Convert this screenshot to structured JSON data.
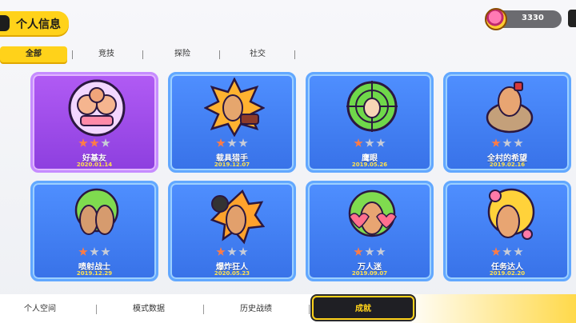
{
  "header": {
    "title": "个人信息",
    "coins": "3330"
  },
  "tabs": [
    {
      "label": "全部",
      "active": true
    },
    {
      "label": "竞技",
      "active": false
    },
    {
      "label": "探险",
      "active": false
    },
    {
      "label": "社交",
      "active": false
    }
  ],
  "achievements": [
    {
      "name": "好基友",
      "date": "2020.01.14",
      "color": "purple",
      "stars": [
        true,
        true,
        false
      ],
      "icon": "twin-fighters-icon"
    },
    {
      "name": "载具猎手",
      "date": "2019.12.07",
      "color": "blue",
      "stars": [
        true,
        false,
        false
      ],
      "icon": "vehicle-hunter-icon"
    },
    {
      "name": "鹰眼",
      "date": "2019.05.26",
      "color": "blue",
      "stars": [
        true,
        false,
        false
      ],
      "icon": "eagle-eye-scope-icon"
    },
    {
      "name": "全村的希望",
      "date": "2019.02.16",
      "color": "blue",
      "stars": [
        true,
        false,
        false
      ],
      "icon": "village-hope-icon"
    },
    {
      "name": "喷射战士",
      "date": "2019.12.29",
      "color": "blue",
      "stars": [
        true,
        false,
        false
      ],
      "icon": "spray-warrior-icon"
    },
    {
      "name": "爆炸狂人",
      "date": "2020.05.23",
      "color": "blue",
      "stars": [
        true,
        false,
        false
      ],
      "icon": "explosion-maniac-icon"
    },
    {
      "name": "万人迷",
      "date": "2019.09.07",
      "color": "blue",
      "stars": [
        true,
        false,
        false
      ],
      "icon": "heartthrob-icon"
    },
    {
      "name": "任务达人",
      "date": "2019.02.20",
      "color": "blue",
      "stars": [
        true,
        false,
        false
      ],
      "icon": "mission-expert-icon"
    }
  ],
  "bottom_nav": [
    {
      "label": "个人空间",
      "active": false
    },
    {
      "label": "模式数据",
      "active": false
    },
    {
      "label": "历史战绩",
      "active": false
    },
    {
      "label": "成就",
      "active": true
    }
  ],
  "colors": {
    "accent": "#ffd21a",
    "card_blue": "#3d7ef0",
    "card_purple": "#a24df0",
    "date_text": "#ffe14d"
  }
}
